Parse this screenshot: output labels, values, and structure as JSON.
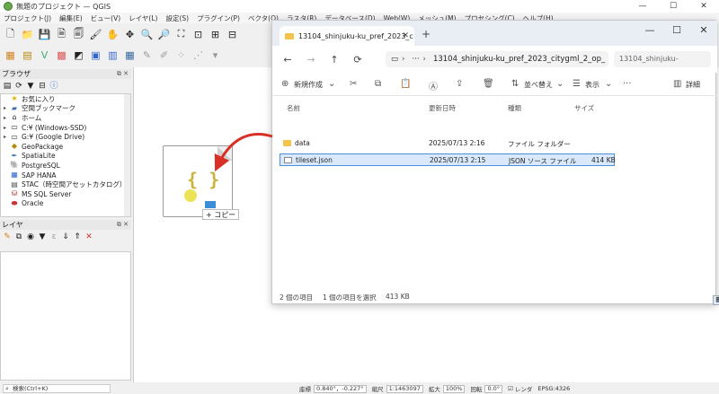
{
  "qgis": {
    "title": "無題のプロジェクト — QGIS",
    "menu": [
      "プロジェクト(J)",
      "編集(E)",
      "ビュー(V)",
      "レイヤ(L)",
      "設定(S)",
      "プラグイン(P)",
      "ベクタ(O)",
      "ラスタ(R)",
      "データベース(D)",
      "Web(W)",
      "メッシュ(M)",
      "プロセシング(C)",
      "ヘルプ(H)"
    ],
    "browser_panel": {
      "title": "ブラウザ",
      "items": [
        {
          "label": "お気に入り",
          "icon": "star-icon",
          "expand": ""
        },
        {
          "label": "空間ブックマーク",
          "icon": "bookmark-icon",
          "expand": "▸"
        },
        {
          "label": "ホーム",
          "icon": "home-icon",
          "expand": "▸"
        },
        {
          "label": "C:¥ (Windows-SSD)",
          "icon": "drive-icon",
          "expand": "▸"
        },
        {
          "label": "G:¥ (Google Drive)",
          "icon": "drive-icon",
          "expand": "▸"
        },
        {
          "label": "GeoPackage",
          "icon": "geopackage-icon",
          "expand": ""
        },
        {
          "label": "SpatiaLite",
          "icon": "spatialite-icon",
          "expand": ""
        },
        {
          "label": "PostgreSQL",
          "icon": "postgresql-icon",
          "expand": ""
        },
        {
          "label": "SAP HANA",
          "icon": "hana-icon",
          "expand": ""
        },
        {
          "label": "STAC（時空間アセットカタログ）",
          "icon": "stac-icon",
          "expand": ""
        },
        {
          "label": "MS SQL Server",
          "icon": "mssql-icon",
          "expand": ""
        },
        {
          "label": "Oracle",
          "icon": "oracle-icon",
          "expand": ""
        }
      ]
    },
    "layers_panel": {
      "title": "レイヤ"
    },
    "status": {
      "search_placeholder": "検索(Ctrl+K)",
      "coord_label": "座標",
      "coord_value": "0.840°，-0.227°",
      "scale_label": "縮尺",
      "scale_value": "1:1463097",
      "magnifier_label": "拡大",
      "magnifier_value": "100%",
      "rotation_label": "回転",
      "rotation_value": "0.0°",
      "render_label": "レンダ",
      "crs": "EPSG:4326"
    }
  },
  "drag": {
    "copy_label": "+ コピー"
  },
  "explorer": {
    "tab_title": "13104_shinjuku-ku_pref_2023_c",
    "path": "13104_shinjuku-ku_pref_2023_citygml_2_op_",
    "search_placeholder": "13104_shinjuku-",
    "commands": {
      "new": "新規作成",
      "sort": "並べ替え",
      "view": "表示",
      "details": "詳細"
    },
    "columns": [
      "名前",
      "更新日時",
      "種類",
      "サイズ"
    ],
    "rows": [
      {
        "name": "data",
        "modified": "2025/07/13 2:16",
        "type": "ファイル フォルダー",
        "size": ""
      },
      {
        "name": "tileset.json",
        "modified": "2025/07/13 2:15",
        "type": "JSON ソース ファイル",
        "size": "414 KB"
      }
    ],
    "status": {
      "count": "2 個の項目",
      "selected": "1 個の項目を選択",
      "selected_size": "413 KB"
    }
  },
  "colors": {
    "arrow": "#d93025",
    "selection": "#d9e9fb",
    "folder": "#f3c34b"
  }
}
